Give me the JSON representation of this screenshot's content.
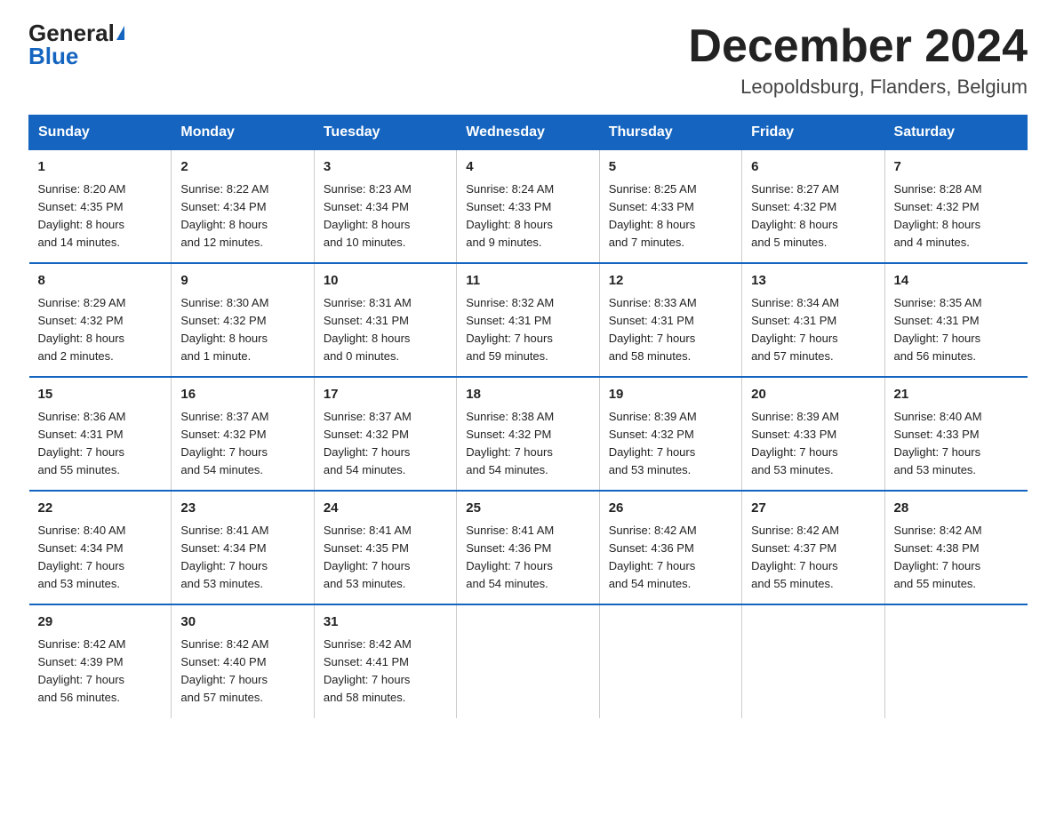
{
  "logo": {
    "general": "General",
    "blue": "Blue",
    "triangle": "▶"
  },
  "title": "December 2024",
  "subtitle": "Leopoldsburg, Flanders, Belgium",
  "days_of_week": [
    "Sunday",
    "Monday",
    "Tuesday",
    "Wednesday",
    "Thursday",
    "Friday",
    "Saturday"
  ],
  "weeks": [
    [
      {
        "day": "1",
        "info": "Sunrise: 8:20 AM\nSunset: 4:35 PM\nDaylight: 8 hours\nand 14 minutes."
      },
      {
        "day": "2",
        "info": "Sunrise: 8:22 AM\nSunset: 4:34 PM\nDaylight: 8 hours\nand 12 minutes."
      },
      {
        "day": "3",
        "info": "Sunrise: 8:23 AM\nSunset: 4:34 PM\nDaylight: 8 hours\nand 10 minutes."
      },
      {
        "day": "4",
        "info": "Sunrise: 8:24 AM\nSunset: 4:33 PM\nDaylight: 8 hours\nand 9 minutes."
      },
      {
        "day": "5",
        "info": "Sunrise: 8:25 AM\nSunset: 4:33 PM\nDaylight: 8 hours\nand 7 minutes."
      },
      {
        "day": "6",
        "info": "Sunrise: 8:27 AM\nSunset: 4:32 PM\nDaylight: 8 hours\nand 5 minutes."
      },
      {
        "day": "7",
        "info": "Sunrise: 8:28 AM\nSunset: 4:32 PM\nDaylight: 8 hours\nand 4 minutes."
      }
    ],
    [
      {
        "day": "8",
        "info": "Sunrise: 8:29 AM\nSunset: 4:32 PM\nDaylight: 8 hours\nand 2 minutes."
      },
      {
        "day": "9",
        "info": "Sunrise: 8:30 AM\nSunset: 4:32 PM\nDaylight: 8 hours\nand 1 minute."
      },
      {
        "day": "10",
        "info": "Sunrise: 8:31 AM\nSunset: 4:31 PM\nDaylight: 8 hours\nand 0 minutes."
      },
      {
        "day": "11",
        "info": "Sunrise: 8:32 AM\nSunset: 4:31 PM\nDaylight: 7 hours\nand 59 minutes."
      },
      {
        "day": "12",
        "info": "Sunrise: 8:33 AM\nSunset: 4:31 PM\nDaylight: 7 hours\nand 58 minutes."
      },
      {
        "day": "13",
        "info": "Sunrise: 8:34 AM\nSunset: 4:31 PM\nDaylight: 7 hours\nand 57 minutes."
      },
      {
        "day": "14",
        "info": "Sunrise: 8:35 AM\nSunset: 4:31 PM\nDaylight: 7 hours\nand 56 minutes."
      }
    ],
    [
      {
        "day": "15",
        "info": "Sunrise: 8:36 AM\nSunset: 4:31 PM\nDaylight: 7 hours\nand 55 minutes."
      },
      {
        "day": "16",
        "info": "Sunrise: 8:37 AM\nSunset: 4:32 PM\nDaylight: 7 hours\nand 54 minutes."
      },
      {
        "day": "17",
        "info": "Sunrise: 8:37 AM\nSunset: 4:32 PM\nDaylight: 7 hours\nand 54 minutes."
      },
      {
        "day": "18",
        "info": "Sunrise: 8:38 AM\nSunset: 4:32 PM\nDaylight: 7 hours\nand 54 minutes."
      },
      {
        "day": "19",
        "info": "Sunrise: 8:39 AM\nSunset: 4:32 PM\nDaylight: 7 hours\nand 53 minutes."
      },
      {
        "day": "20",
        "info": "Sunrise: 8:39 AM\nSunset: 4:33 PM\nDaylight: 7 hours\nand 53 minutes."
      },
      {
        "day": "21",
        "info": "Sunrise: 8:40 AM\nSunset: 4:33 PM\nDaylight: 7 hours\nand 53 minutes."
      }
    ],
    [
      {
        "day": "22",
        "info": "Sunrise: 8:40 AM\nSunset: 4:34 PM\nDaylight: 7 hours\nand 53 minutes."
      },
      {
        "day": "23",
        "info": "Sunrise: 8:41 AM\nSunset: 4:34 PM\nDaylight: 7 hours\nand 53 minutes."
      },
      {
        "day": "24",
        "info": "Sunrise: 8:41 AM\nSunset: 4:35 PM\nDaylight: 7 hours\nand 53 minutes."
      },
      {
        "day": "25",
        "info": "Sunrise: 8:41 AM\nSunset: 4:36 PM\nDaylight: 7 hours\nand 54 minutes."
      },
      {
        "day": "26",
        "info": "Sunrise: 8:42 AM\nSunset: 4:36 PM\nDaylight: 7 hours\nand 54 minutes."
      },
      {
        "day": "27",
        "info": "Sunrise: 8:42 AM\nSunset: 4:37 PM\nDaylight: 7 hours\nand 55 minutes."
      },
      {
        "day": "28",
        "info": "Sunrise: 8:42 AM\nSunset: 4:38 PM\nDaylight: 7 hours\nand 55 minutes."
      }
    ],
    [
      {
        "day": "29",
        "info": "Sunrise: 8:42 AM\nSunset: 4:39 PM\nDaylight: 7 hours\nand 56 minutes."
      },
      {
        "day": "30",
        "info": "Sunrise: 8:42 AM\nSunset: 4:40 PM\nDaylight: 7 hours\nand 57 minutes."
      },
      {
        "day": "31",
        "info": "Sunrise: 8:42 AM\nSunset: 4:41 PM\nDaylight: 7 hours\nand 58 minutes."
      },
      {
        "day": "",
        "info": ""
      },
      {
        "day": "",
        "info": ""
      },
      {
        "day": "",
        "info": ""
      },
      {
        "day": "",
        "info": ""
      }
    ]
  ]
}
